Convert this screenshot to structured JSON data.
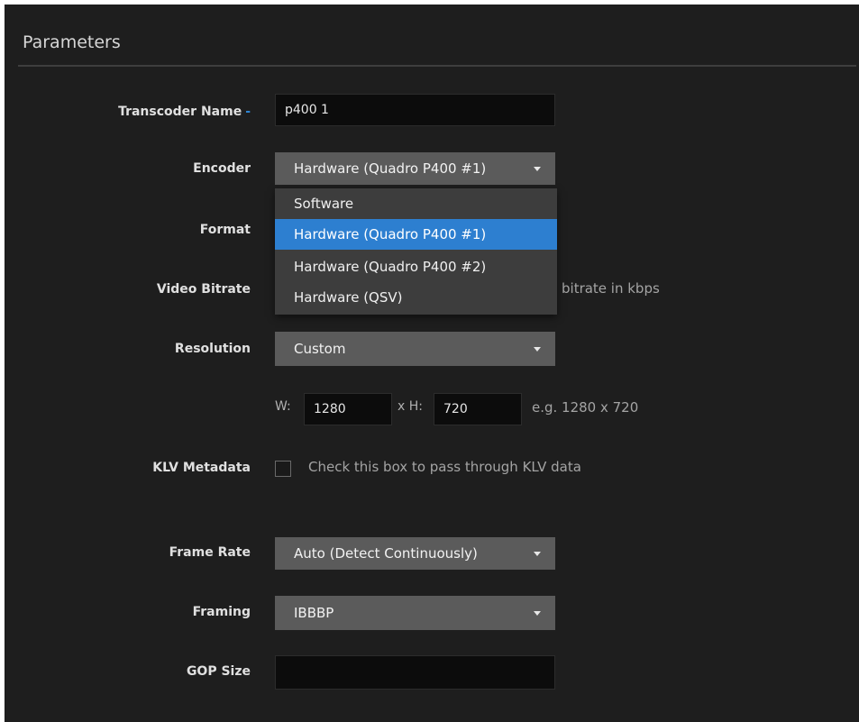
{
  "panel": {
    "title": "Parameters"
  },
  "transcoder_name": {
    "label": "Transcoder Name",
    "required_marker": "-",
    "value": "p400 1"
  },
  "encoder": {
    "label": "Encoder",
    "selected": "Hardware (Quadro P400 #1)",
    "options": [
      {
        "label": "Software",
        "highlighted": false
      },
      {
        "label": "Hardware (Quadro P400 #1)",
        "highlighted": true
      },
      {
        "label": "Hardware (Quadro P400 #2)",
        "highlighted": false
      },
      {
        "label": "Hardware (QSV)",
        "highlighted": false
      }
    ]
  },
  "format": {
    "label": "Format"
  },
  "video_bitrate": {
    "label": "Video Bitrate",
    "help": "bitrate in kbps"
  },
  "resolution": {
    "label": "Resolution",
    "selected": "Custom",
    "width_label": "W:",
    "width_value": "1280",
    "height_label": "x H:",
    "height_value": "720",
    "example": "e.g. 1280 x 720"
  },
  "klv_metadata": {
    "label": "KLV Metadata",
    "checkbox_text": "Check this box to pass through KLV data",
    "checked": false
  },
  "frame_rate": {
    "label": "Frame Rate",
    "selected": "Auto (Detect Continuously)"
  },
  "framing": {
    "label": "Framing",
    "selected": "IBBBP"
  },
  "gop_size": {
    "label": "GOP Size",
    "value": ""
  },
  "colors": {
    "panel_bg": "#1e1e1e",
    "accent": "#2d7fd0",
    "select_bg": "#5b5b5b",
    "input_bg": "#0c0c0c"
  }
}
